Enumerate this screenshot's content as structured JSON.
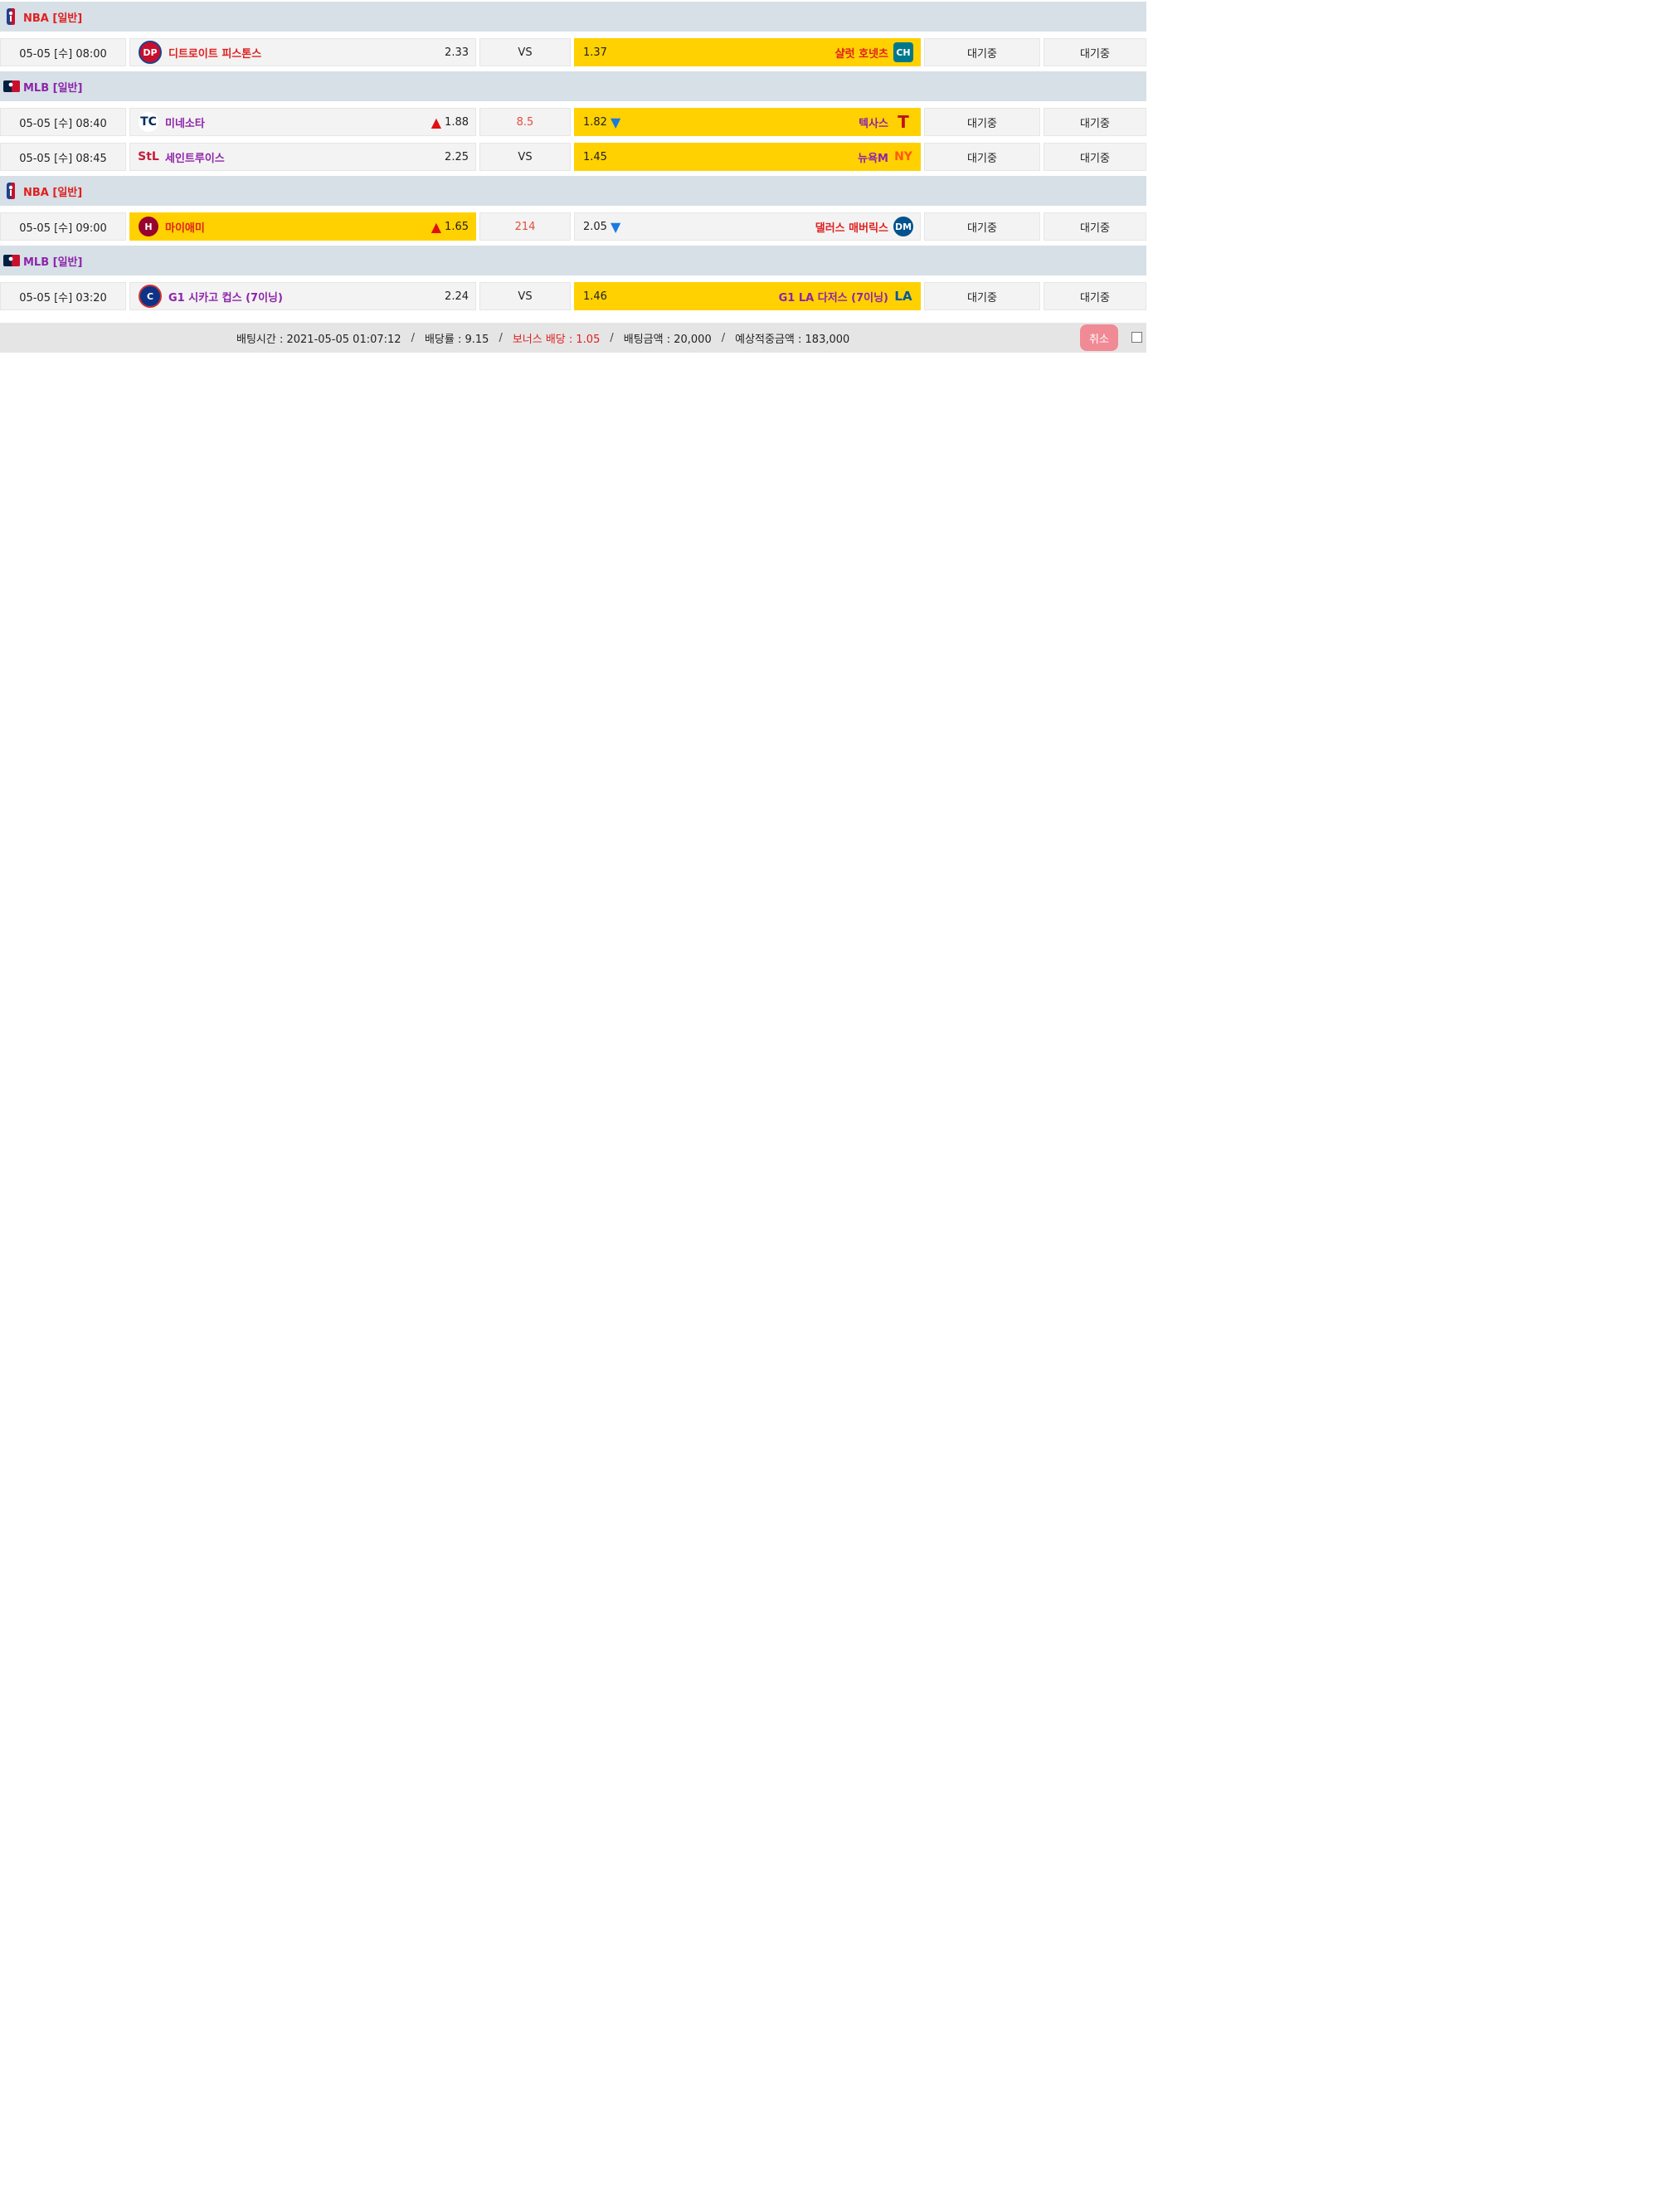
{
  "leagues": [
    {
      "name": "NBA [일반]",
      "sport_icon": "basketball-league-icon",
      "name_color": "#e02020",
      "matches": [
        {
          "datetime": "05-05 [수] 08:00",
          "home": {
            "name": "디트로이트 피스톤스",
            "odd": "2.33",
            "name_color": "#e02020",
            "selected": false,
            "arrow": ""
          },
          "mid": "VS",
          "away": {
            "name": "샬럿 호넷츠",
            "odd": "1.37",
            "name_color": "#e02020",
            "selected": true,
            "arrow": ""
          },
          "status1": "대기중",
          "status2": "대기중"
        }
      ]
    },
    {
      "name": "MLB [일반]",
      "sport_icon": "baseball-league-icon",
      "name_color": "#8e24aa",
      "matches": [
        {
          "datetime": "05-05 [수] 08:40",
          "home": {
            "name": "미네소타",
            "odd": "1.88",
            "name_color": "#8e24aa",
            "selected": false,
            "arrow": "up"
          },
          "mid": "8.5",
          "away": {
            "name": "텍사스",
            "odd": "1.82",
            "name_color": "#8e24aa",
            "selected": true,
            "arrow": "down"
          },
          "status1": "대기중",
          "status2": "대기중"
        },
        {
          "datetime": "05-05 [수] 08:45",
          "home": {
            "name": "세인트루이스",
            "odd": "2.25",
            "name_color": "#8e24aa",
            "selected": false,
            "arrow": ""
          },
          "mid": "VS",
          "away": {
            "name": "뉴욕M",
            "odd": "1.45",
            "name_color": "#8e24aa",
            "selected": true,
            "arrow": ""
          },
          "status1": "대기중",
          "status2": "대기중"
        }
      ]
    },
    {
      "name": "NBA [일반]",
      "sport_icon": "basketball-league-icon",
      "name_color": "#e02020",
      "matches": [
        {
          "datetime": "05-05 [수] 09:00",
          "home": {
            "name": "마이애미",
            "odd": "1.65",
            "name_color": "#e02020",
            "selected": true,
            "arrow": "up"
          },
          "mid": "214",
          "away": {
            "name": "댈러스 매버릭스",
            "odd": "2.05",
            "name_color": "#e02020",
            "selected": false,
            "arrow": "down"
          },
          "status1": "대기중",
          "status2": "대기중"
        }
      ]
    },
    {
      "name": "MLB [일반]",
      "sport_icon": "baseball-league-icon",
      "name_color": "#8e24aa",
      "matches": [
        {
          "datetime": "05-05 [수] 03:20",
          "home": {
            "name": "G1 시카고 컵스 (7이닝)",
            "odd": "2.24",
            "name_color": "#8e24aa",
            "selected": false,
            "arrow": ""
          },
          "mid": "VS",
          "away": {
            "name": "G1 LA 다저스 (7이닝)",
            "odd": "1.46",
            "name_color": "#8e24aa",
            "selected": true,
            "arrow": ""
          },
          "status1": "대기중",
          "status2": "대기중"
        }
      ]
    }
  ],
  "footer": {
    "bet_time_label": "배팅시간 : 2021-05-05 01:07:12",
    "odds_label": "배당률 : 9.15",
    "bonus_label": "보너스 배당 : 1.05",
    "amount_label": "배팅금액 : 20,000",
    "expected_label": "예상적중금액 : 183,000",
    "separator": "/",
    "cancel_button": "취소"
  },
  "colors": {
    "selected_bg": "#ffd100",
    "league_bar": "#d6e0e6",
    "cancel_bg": "#f08a95",
    "over_under_text": "#e74c3c"
  }
}
